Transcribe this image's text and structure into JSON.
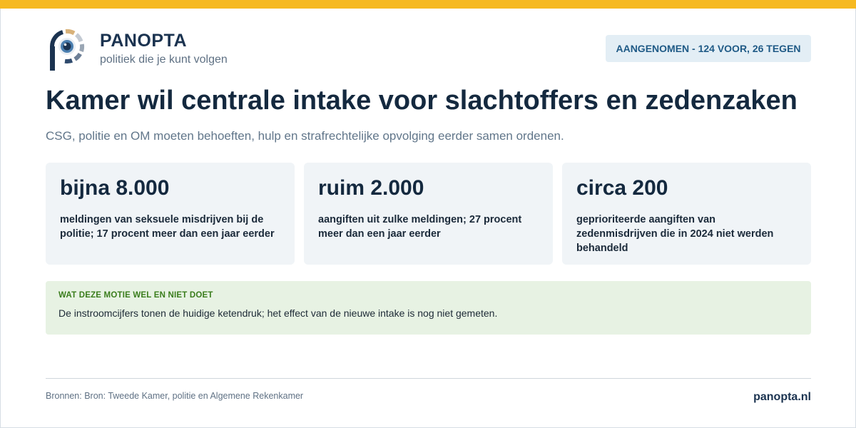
{
  "brand": {
    "name": "PANOPTA",
    "tagline": "politiek die je kunt volgen"
  },
  "status": {
    "label": "AANGENOMEN - 124 VOOR, 26 TEGEN"
  },
  "article": {
    "headline": "Kamer wil centrale intake voor slachtoffers en zedenzaken",
    "subhead": "CSG, politie en OM moeten behoeften, hulp en strafrechtelijke opvolging eerder samen ordenen."
  },
  "stats": [
    {
      "value": "bijna 8.000",
      "description": "meldingen van seksuele misdrijven bij de politie; 17 procent meer dan een jaar eerder"
    },
    {
      "value": "ruim 2.000",
      "description": "aangiften uit zulke meldingen; 27 procent meer dan een jaar eerder"
    },
    {
      "value": "circa 200",
      "description": "geprioriteerde aangiften van zedenmisdrijven die in 2024 niet werden behandeld"
    }
  ],
  "note": {
    "title": "WAT DEZE MOTIE WEL EN NIET DOET",
    "text": "De instroomcijfers tonen de huidige ketendruk; het effect van de nieuwe intake is nog niet gemeten."
  },
  "footer": {
    "sources": "Bronnen: Bron: Tweede Kamer, politie en Algemene Rekenkamer",
    "site": "panopta.nl"
  },
  "colors": {
    "accent_bar": "#f6b921",
    "brand_navy": "#1b3350",
    "badge_bg": "#e3eef5",
    "badge_text": "#1f5a86",
    "card_bg": "#f0f4f7",
    "note_bg": "#e7f2e3",
    "note_title": "#3a7d1c"
  },
  "icons": {
    "logo": "panopta-eye-logo"
  }
}
